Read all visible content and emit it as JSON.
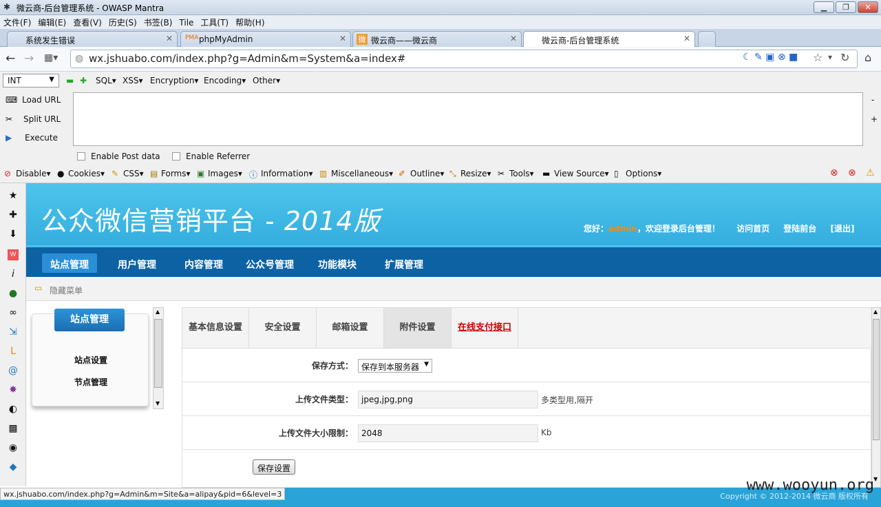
{
  "window": {
    "title": "微云商-后台管理系统 - OWASP Mantra",
    "min": "▁",
    "max": "❐",
    "close": "✕"
  },
  "menubar": [
    "文件(F)",
    "编辑(E)",
    "查看(V)",
    "历史(S)",
    "书签(B)",
    "Tile",
    "工具(T)",
    "帮助(H)"
  ],
  "browser_tabs": [
    "系统发生错误",
    "phpMyAdmin",
    "微云商——微云商",
    "微云商-后台管理系统"
  ],
  "url": "wx.jshuabo.com/index.php?g=Admin&m=System&a=index#",
  "hackbar": {
    "select": "INT",
    "menus": [
      "SQL▾",
      "XSS▾",
      "Encryption▾",
      "Encoding▾",
      "Other▾"
    ],
    "load": "Load URL",
    "split": "Split URL",
    "execute": "Execute",
    "post": "Enable Post data",
    "referrer": "Enable Referrer"
  },
  "webdev": [
    "Disable▾",
    "Cookies▾",
    "CSS▾",
    "Forms▾",
    "Images▾",
    "Information▾",
    "Miscellaneous▾",
    "Outline▾",
    "Resize▾",
    "Tools▾",
    "View Source▾",
    "Options▾"
  ],
  "site": {
    "logo_cn": "公众微信营销平台 - ",
    "logo_ver": "2014版",
    "greet_pre": "您好：",
    "user": "admin",
    "greet_post": "，欢迎登录后台管理！",
    "visit": "访问首页",
    "front": "登陆前台",
    "logout": "[退出]"
  },
  "nav": [
    "站点管理",
    "用户管理",
    "内容管理",
    "公众号管理",
    "功能模块",
    "扩展管理"
  ],
  "crumb": "隐藏菜单",
  "left": {
    "header": "站点管理",
    "items": [
      "站点设置",
      "节点管理"
    ]
  },
  "tabs": [
    "基本信息设置",
    "安全设置",
    "邮箱设置",
    "附件设置",
    "在线支付接口"
  ],
  "form": {
    "storage_label": "保存方式：",
    "storage_value": "保存到本服务器",
    "type_label": "上传文件类型：",
    "type_value": "jpeg,jpg,png",
    "type_hint": "多类型用,隔开",
    "size_label": "上传文件大小限制：",
    "size_value": "2048",
    "size_hint": "Kb",
    "save": "保存设置"
  },
  "status": "wx.jshuabo.com/index.php?g=Admin&m=Site&a=alipay&pid=6&level=3",
  "copyright": "Copyright © 2012-2014 微云商 版权所有",
  "watermark": "www.wooyun.org"
}
